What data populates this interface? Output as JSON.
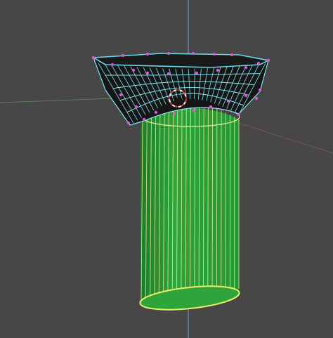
{
  "viewport": {
    "background": "#474747",
    "grid_axis_colors": {
      "y_axis": "#7aa0c8",
      "x_axis": "#8a5a5a",
      "z_axis": "#6a8a6a"
    }
  },
  "mesh": {
    "column_fill": "#2ea43a",
    "column_fill_dark": "#1f7a2a",
    "column_wire": "#e7f59a",
    "capital_fill": "#161616",
    "capital_wire": "#7fe6f0",
    "capital_rim_wire": "#6ad8e8",
    "selected_vertex_color": "#d35ad6",
    "base_edge_color": "#ecf06a"
  },
  "gizmo": {
    "name": "3d-cursor",
    "ring_color": "#e23a3a",
    "ring_alt_color": "#ffffff"
  }
}
